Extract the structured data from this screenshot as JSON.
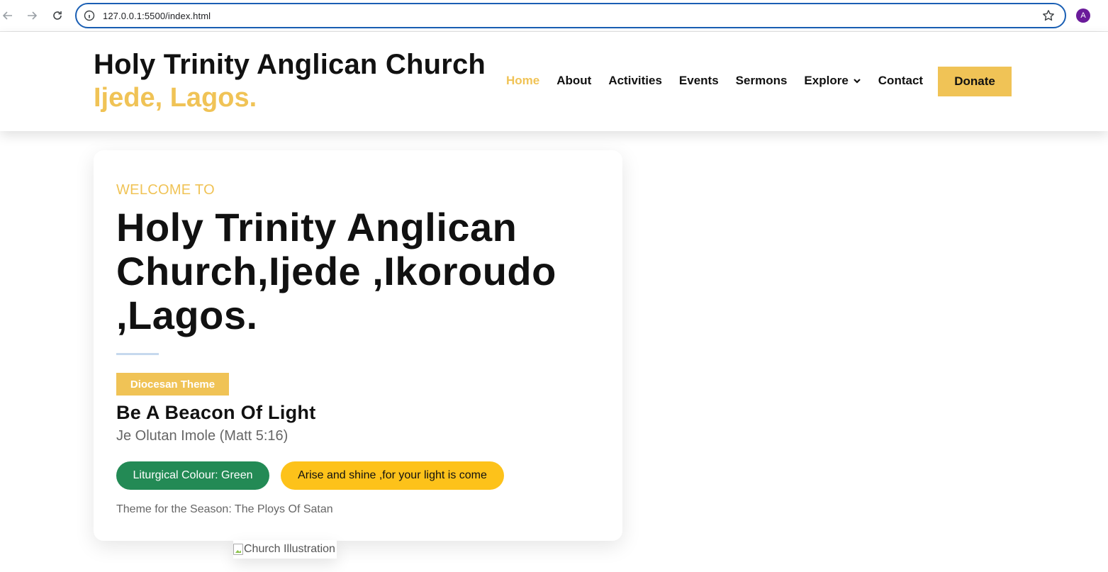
{
  "browser": {
    "url": "127.0.0.1:5500/index.html",
    "profile_initial": "A",
    "profile_color": "#6a1b9a"
  },
  "header": {
    "brand_line1": "Holy Trinity Anglican Church",
    "brand_line2": "Ijede, Lagos.",
    "brand_accent_color": "#f0c356",
    "nav": [
      {
        "label": "Home",
        "active": true
      },
      {
        "label": "About"
      },
      {
        "label": "Activities"
      },
      {
        "label": "Events"
      },
      {
        "label": "Sermons"
      },
      {
        "label": "Explore",
        "dropdown": true
      },
      {
        "label": "Contact"
      }
    ],
    "donate_label": "Donate"
  },
  "hero": {
    "welcome": "WELCOME TO",
    "title": "Holy Trinity Anglican Church,Ijede ,Ikoroudo ,Lagos.",
    "theme_badge": "Diocesan Theme",
    "theme_title": "Be A Beacon Of Light",
    "theme_sub": "Je Olutan Imole (Matt 5:16)",
    "liturgical_pill": "Liturgical Colour: Green",
    "liturgical_color": "#238a55",
    "verse_pill": "Arise and shine ,for your light is come",
    "verse_pill_color": "#fdc21a",
    "season": "Theme for the Season: The Ploys Of Satan"
  },
  "illustration": {
    "alt": "Church Illustration"
  },
  "icons": {
    "back": "arrow-left-icon",
    "forward": "arrow-right-icon",
    "reload": "reload-icon",
    "info": "info-icon",
    "star": "star-icon",
    "dropdown": "chevron-down-icon",
    "broken_image": "broken-image-icon"
  }
}
